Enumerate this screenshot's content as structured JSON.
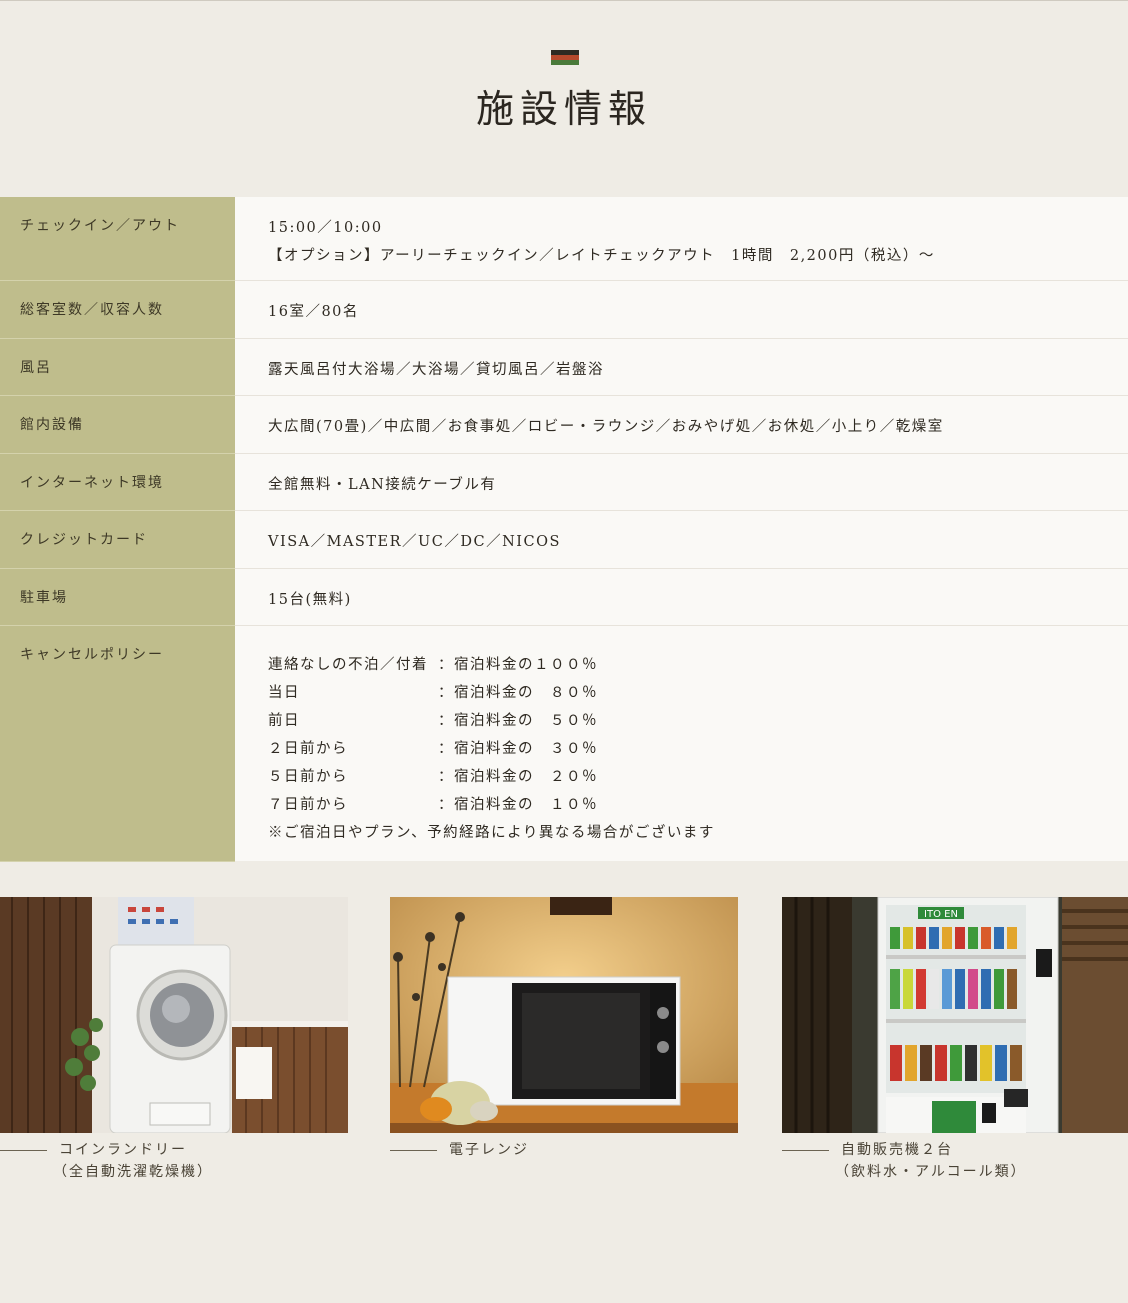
{
  "header": {
    "title": "施設情報",
    "flag_colors": [
      "#2e2a22",
      "#b5492c",
      "#4a7a3a"
    ]
  },
  "info_rows": [
    {
      "label": "チェックイン／アウト",
      "lines": [
        "15:00／10:00",
        "【オプション】アーリーチェックイン／レイトチェックアウト　1時間　2,200円（税込）～"
      ]
    },
    {
      "label": "総客室数／収容人数",
      "lines": [
        "16室／80名"
      ]
    },
    {
      "label": "風呂",
      "lines": [
        "露天風呂付大浴場／大浴場／貸切風呂／岩盤浴"
      ]
    },
    {
      "label": "館内設備",
      "lines": [
        "大広間(70畳)／中広間／お食事処／ロビー・ラウンジ／おみやげ処／お休処／小上り／乾燥室"
      ]
    },
    {
      "label": "インターネット環境",
      "lines": [
        "全館無料・LAN接続ケーブル有"
      ]
    },
    {
      "label": "クレジットカード",
      "lines": [
        "VISA／MASTER／UC／DC／NICOS"
      ]
    },
    {
      "label": "駐車場",
      "lines": [
        "15台(無料)"
      ]
    }
  ],
  "cancel_policy": {
    "label": "キャンセルポリシー",
    "rows": [
      {
        "when": "連絡なしの不泊／付着",
        "fee": "：宿泊料金の１００％"
      },
      {
        "when": "当日",
        "fee": "：宿泊料金の　８０％"
      },
      {
        "when": "前日",
        "fee": "：宿泊料金の　５０％"
      },
      {
        "when": "２日前から",
        "fee": "：宿泊料金の　３０％"
      },
      {
        "when": "５日前から",
        "fee": "：宿泊料金の　２０％"
      },
      {
        "when": "７日前から",
        "fee": "：宿泊料金の　１０％"
      }
    ],
    "note": "※ご宿泊日やプラン、予約経路により異なる場合がございます"
  },
  "photos": [
    {
      "name": "laundry",
      "caption": "コインランドリー",
      "sub": "（全自動洗濯乾燥機）"
    },
    {
      "name": "microwave",
      "caption": "電子レンジ",
      "sub": ""
    },
    {
      "name": "vending",
      "caption": "自動販売機２台",
      "sub": "（飲料水・アルコール類）",
      "brand": "ITO EN"
    }
  ]
}
